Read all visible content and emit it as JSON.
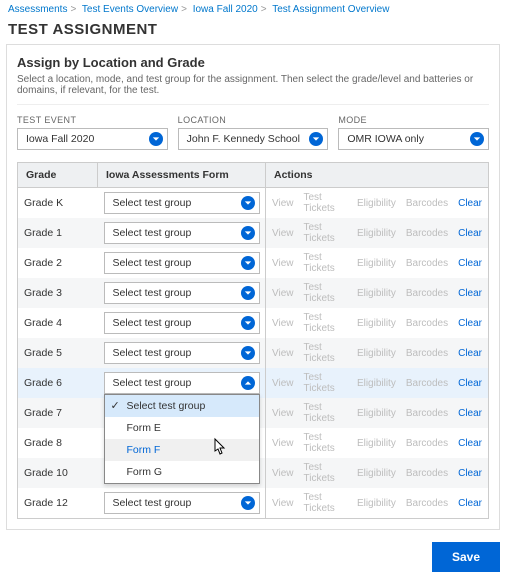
{
  "breadcrumb": [
    "Assessments",
    "Test Events Overview",
    "Iowa Fall 2020",
    "Test Assignment Overview"
  ],
  "page_title": "TEST ASSIGNMENT",
  "section_title": "Assign by Location and Grade",
  "hint": "Select a location, mode, and test group for the assignment. Then select the grade/level and batteries or domains, if relevant, for the test.",
  "filters": {
    "test_event": {
      "label": "TEST EVENT",
      "value": "Iowa Fall 2020"
    },
    "location": {
      "label": "LOCATION",
      "value": "John F. Kennedy School"
    },
    "mode": {
      "label": "MODE",
      "value": "OMR IOWA only"
    }
  },
  "columns": {
    "grade": "Grade",
    "form": "Iowa Assessments Form",
    "actions": "Actions"
  },
  "form_placeholder": "Select test group",
  "action_labels": {
    "view": "View",
    "tickets": "Test Tickets",
    "eligibility": "Eligibility",
    "barcodes": "Barcodes",
    "clear": "Clear"
  },
  "rows": [
    {
      "grade": "Grade K",
      "open": false
    },
    {
      "grade": "Grade 1",
      "open": false
    },
    {
      "grade": "Grade 2",
      "open": false
    },
    {
      "grade": "Grade 3",
      "open": false
    },
    {
      "grade": "Grade 4",
      "open": false
    },
    {
      "grade": "Grade 5",
      "open": false
    },
    {
      "grade": "Grade 6",
      "open": true
    },
    {
      "grade": "Grade 7",
      "open": false
    },
    {
      "grade": "Grade 8",
      "open": false
    },
    {
      "grade": "Grade 10",
      "open": false
    },
    {
      "grade": "Grade 12",
      "open": false
    }
  ],
  "dropdown_options": [
    {
      "label": "Select test group",
      "selected": true,
      "hover": false
    },
    {
      "label": "Form E",
      "selected": false,
      "hover": false
    },
    {
      "label": "Form F",
      "selected": false,
      "hover": true
    },
    {
      "label": "Form G",
      "selected": false,
      "hover": false
    }
  ],
  "save_label": "Save"
}
